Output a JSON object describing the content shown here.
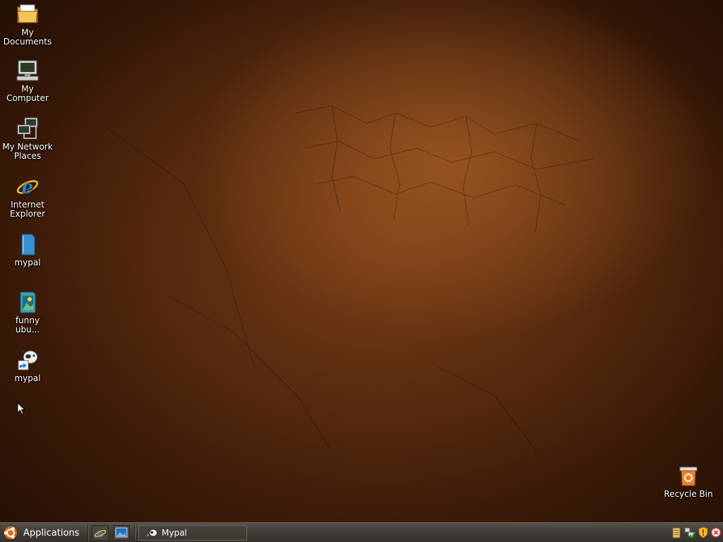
{
  "desktop": {
    "icons": [
      {
        "line1": "My",
        "line2": "Documents",
        "icon": "folder-documents-icon"
      },
      {
        "line1": "My",
        "line2": "Computer",
        "icon": "computer-icon"
      },
      {
        "line1": "My Network",
        "line2": "Places",
        "icon": "network-places-icon"
      },
      {
        "line1": "Internet",
        "line2": "Explorer",
        "icon": "internet-explorer-icon"
      },
      {
        "line1": "mypal",
        "line2": "",
        "icon": "blue-file-icon"
      },
      {
        "line1": "funny",
        "line2": "ubu...",
        "icon": "image-file-icon"
      },
      {
        "line1": "mypal",
        "line2": "",
        "icon": "mypal-shortcut-icon"
      },
      {
        "line1": "Recycle Bin",
        "line2": "",
        "icon": "recycle-bin-icon"
      }
    ]
  },
  "taskbar": {
    "start_label": "Applications",
    "quick_launch": [
      "internet-explorer-icon",
      "show-desktop-icon"
    ],
    "tasks": [
      {
        "label": "Mypal",
        "icon": "mypal-app-icon"
      }
    ],
    "tray": [
      "clipboard-icon",
      "network-status-icon",
      "security-shield-icon",
      "close-circle-icon"
    ]
  },
  "colors": {
    "desktop_base": "#3a1a08",
    "desktop_glow": "#be6e2d",
    "taskbar": "#3f3b36",
    "label_text": "#ffffff"
  }
}
